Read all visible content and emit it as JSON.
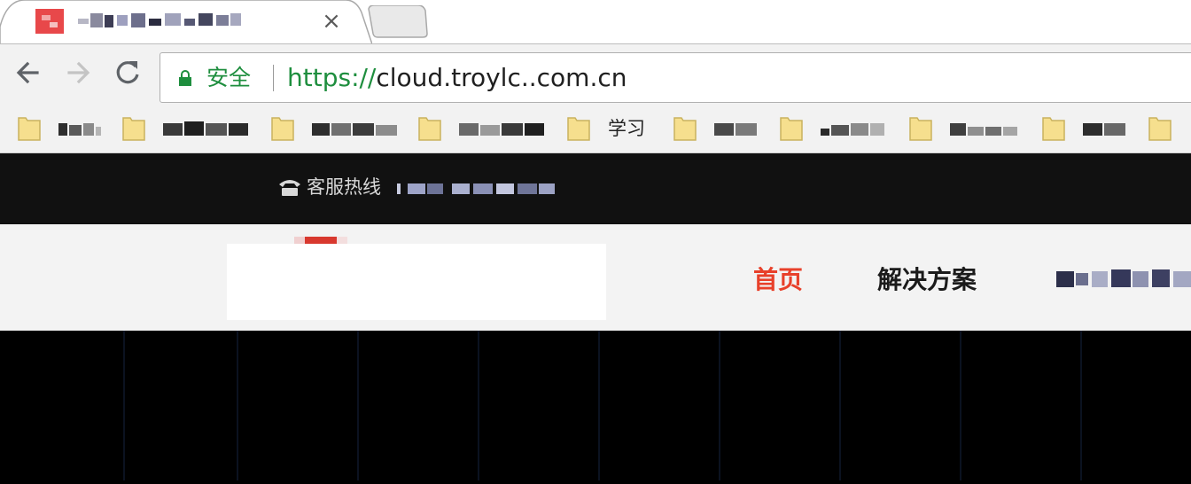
{
  "browser": {
    "tab": {
      "close_glyph": "×"
    },
    "address_bar": {
      "security_label": "安全",
      "url_scheme": "https://",
      "url_rest": "cloud.troylc..com.cn"
    },
    "bookmarks": [
      {
        "label": "",
        "blurred": true
      },
      {
        "label": "",
        "blurred": true
      },
      {
        "label": "",
        "blurred": true
      },
      {
        "label": "",
        "blurred": true
      },
      {
        "label": "学习",
        "blurred": false
      },
      {
        "label": "",
        "blurred": true
      },
      {
        "label": "",
        "blurred": true
      },
      {
        "label": "",
        "blurred": true
      },
      {
        "label": "",
        "blurred": true
      },
      {
        "label": "",
        "blurred": true
      }
    ]
  },
  "site": {
    "topbar": {
      "hotline_label": "客服热线"
    },
    "nav": [
      {
        "label": "首页",
        "active": true
      },
      {
        "label": "解决方案",
        "active": false
      }
    ]
  },
  "colors": {
    "accent_active_nav": "#e8402a",
    "secure_green": "#1e8e3e",
    "topbar_bg": "#111111"
  },
  "icons": [
    "back-arrow-icon",
    "forward-arrow-icon",
    "reload-icon",
    "lock-icon",
    "folder-icon",
    "phone-icon",
    "close-icon"
  ]
}
